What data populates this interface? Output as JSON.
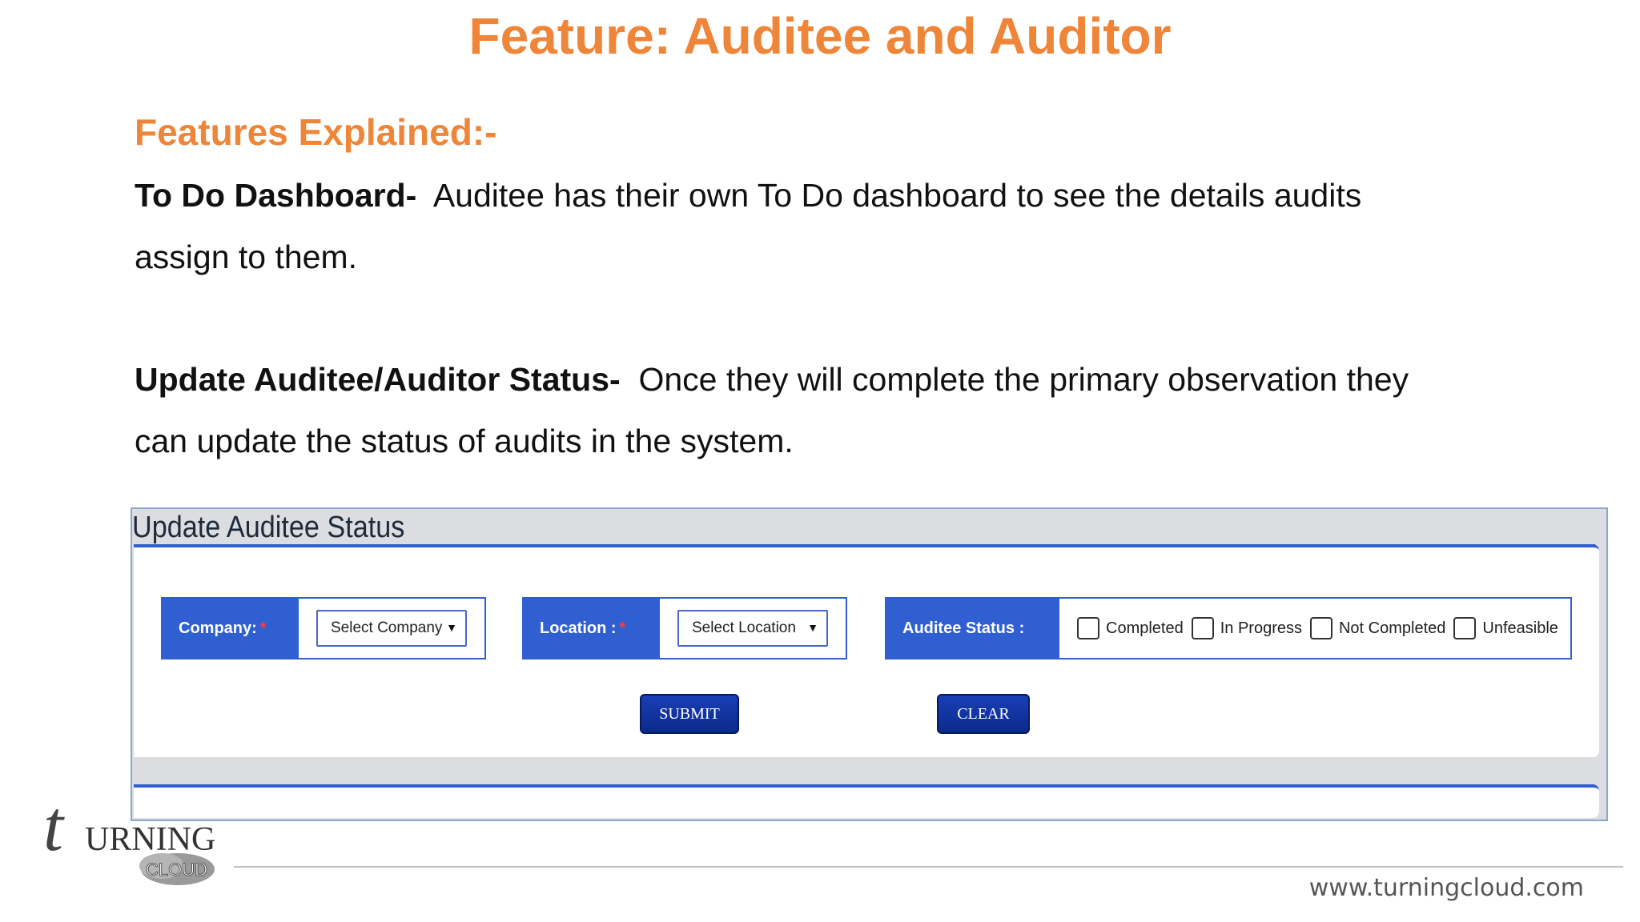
{
  "slide": {
    "title": "Feature: Auditee and Auditor",
    "section_heading": "Features Explained:-",
    "paragraphs": [
      {
        "term": "To Do Dashboard-",
        "text": "Auditee has their own To Do dashboard to see the details audits assign to them."
      },
      {
        "term": "Update Auditee/Auditor Status-",
        "text": "Once they will complete the primary observation they can update the status of audits in the system."
      }
    ]
  },
  "app_panel": {
    "title": "Update Auditee Status",
    "company": {
      "label": "Company:",
      "required_mark": "*",
      "select_value": "Select Company"
    },
    "location": {
      "label": "Location :",
      "required_mark": "*",
      "select_value": "Select Location"
    },
    "auditee_status": {
      "label": "Auditee Status :",
      "options": [
        "Completed",
        "In Progress",
        "Not Completed",
        "Unfeasible"
      ]
    },
    "buttons": {
      "submit": "SUBMIT",
      "clear": "CLEAR"
    }
  },
  "branding": {
    "logo_text_main": "URNING",
    "logo_text_sub": "CLOUD",
    "logo_letter": "t",
    "url": "www.turningcloud.com"
  },
  "colors": {
    "title_orange": "#ee8538",
    "panel_blue": "#2f5fd0",
    "button_blue": "#0b2a8a"
  }
}
